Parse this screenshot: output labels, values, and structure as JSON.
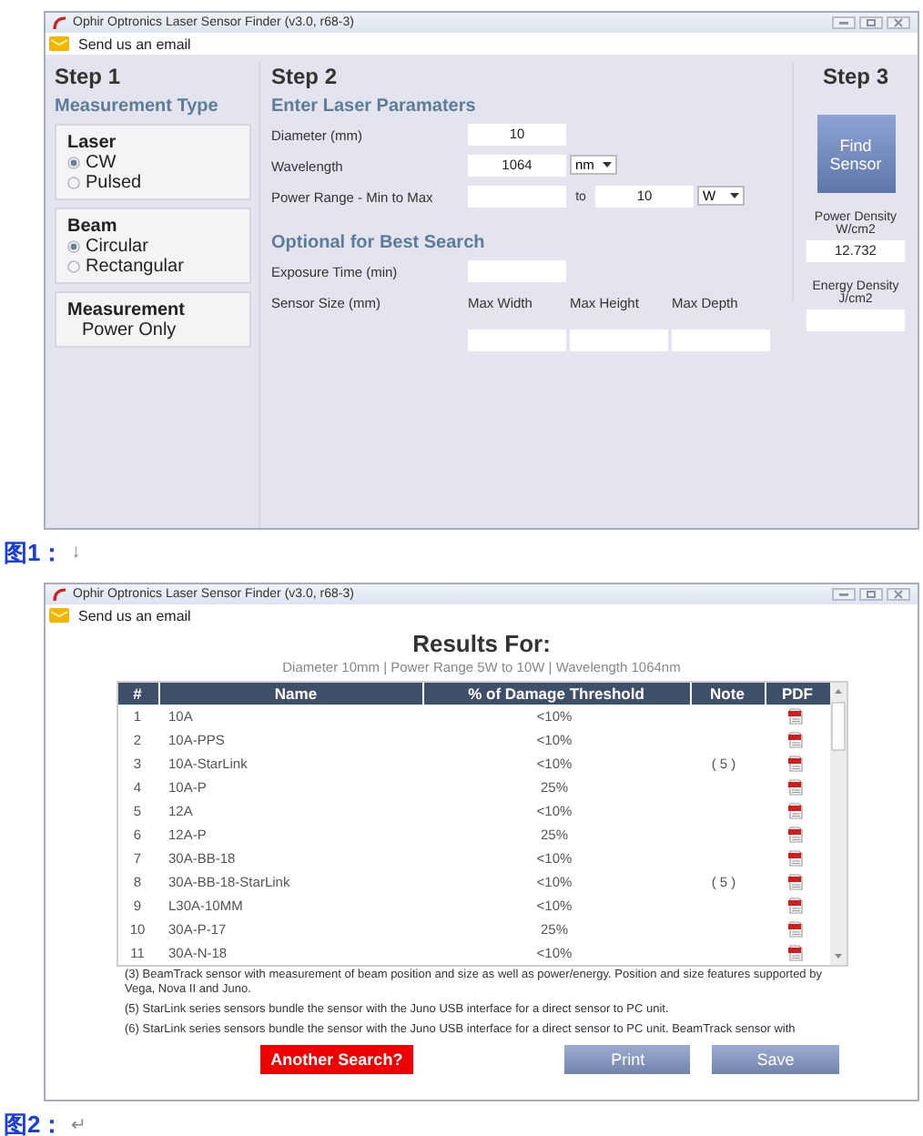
{
  "window_1": {
    "title": "Ophir Optronics Laser Sensor Finder (v3.0, r68-3)",
    "email_link": "Send us an email",
    "step_1": {
      "heading": "Step 1",
      "subheading": "Measurement Type",
      "groups": [
        {
          "kind": "radio",
          "title": "Laser",
          "options": [
            {
              "label": "CW",
              "selected": true
            },
            {
              "label": "Pulsed",
              "selected": false
            }
          ]
        },
        {
          "kind": "radio",
          "title": "Beam",
          "options": [
            {
              "label": "Circular",
              "selected": true
            },
            {
              "label": "Rectangular",
              "selected": false
            }
          ]
        },
        {
          "kind": "value",
          "title": "Measurement",
          "value": "Power Only"
        }
      ]
    },
    "step_2": {
      "heading": "Step 2",
      "section_1": "Enter Laser Paramaters",
      "fields": [
        {
          "kind": "single",
          "label": "Diameter (mm)",
          "value": "10"
        },
        {
          "kind": "unit",
          "label": "Wavelength",
          "value": "1064",
          "unit": "nm"
        },
        {
          "kind": "range",
          "label": "Power Range - Min to Max",
          "separator": "to",
          "max": "10",
          "unit": "W"
        }
      ],
      "section_2": "Optional for Best Search",
      "optional_fields": [
        {
          "kind": "single",
          "label": "Exposure Time (min)"
        },
        {
          "kind": "size",
          "label": "Sensor Size (mm)",
          "columns": [
            "Max Width",
            "Max Height",
            "Max Depth"
          ]
        }
      ]
    },
    "step_3": {
      "heading": "Step 3",
      "button": "Find Sensor",
      "outputs": [
        {
          "label": "Power Density W/cm2",
          "value": "12.732"
        },
        {
          "label": "Energy Density J/cm2"
        }
      ]
    }
  },
  "caption_1": {
    "label": "图1：",
    "mark": "↓"
  },
  "window_2": {
    "title": "Ophir Optronics Laser Sensor Finder (v3.0, r68-3)",
    "email_link": "Send us an email",
    "results_title": "Results For:",
    "subtitle": "Diameter 10mm | Power Range 5W to 10W | Wavelength 1064nm",
    "table": {
      "columns": [
        "#",
        "Name",
        "% of Damage Threshold",
        "Note",
        "PDF"
      ],
      "rows": [
        {
          "number": "1",
          "name": "10A",
          "threshold": "<10%"
        },
        {
          "number": "2",
          "name": "10A-PPS",
          "threshold": "<10%"
        },
        {
          "number": "3",
          "name": "10A-StarLink",
          "threshold": "<10%",
          "note": "( 5 )"
        },
        {
          "number": "4",
          "name": "10A-P",
          "threshold": "25%"
        },
        {
          "number": "5",
          "name": "12A",
          "threshold": "<10%"
        },
        {
          "number": "6",
          "name": "12A-P",
          "threshold": "25%"
        },
        {
          "number": "7",
          "name": "30A-BB-18",
          "threshold": "<10%"
        },
        {
          "number": "8",
          "name": "30A-BB-18-StarLink",
          "threshold": "<10%",
          "note": "( 5 )"
        },
        {
          "number": "9",
          "name": "L30A-10MM",
          "threshold": "<10%"
        },
        {
          "number": "10",
          "name": "30A-P-17",
          "threshold": "25%"
        },
        {
          "number": "11",
          "name": "30A-N-18",
          "threshold": "<10%"
        }
      ]
    },
    "footnotes": [
      "(3)  BeamTrack sensor with measurement of beam position and size as well as power/energy. Position and size features supported by Vega, Nova II and Juno.",
      "(5)  StarLink series sensors bundle the sensor with the Juno USB interface for a direct sensor to PC unit.",
      "(6)  StarLink series sensors bundle the sensor with the Juno USB interface for a direct sensor to PC unit. BeamTrack sensor with"
    ],
    "buttons": [
      {
        "kind": "alert",
        "label": "Another Search?"
      },
      {
        "kind": "plain",
        "label": "Print"
      },
      {
        "kind": "plain",
        "label": "Save"
      }
    ]
  },
  "caption_2": {
    "label": "图2：",
    "mark": "↵"
  }
}
